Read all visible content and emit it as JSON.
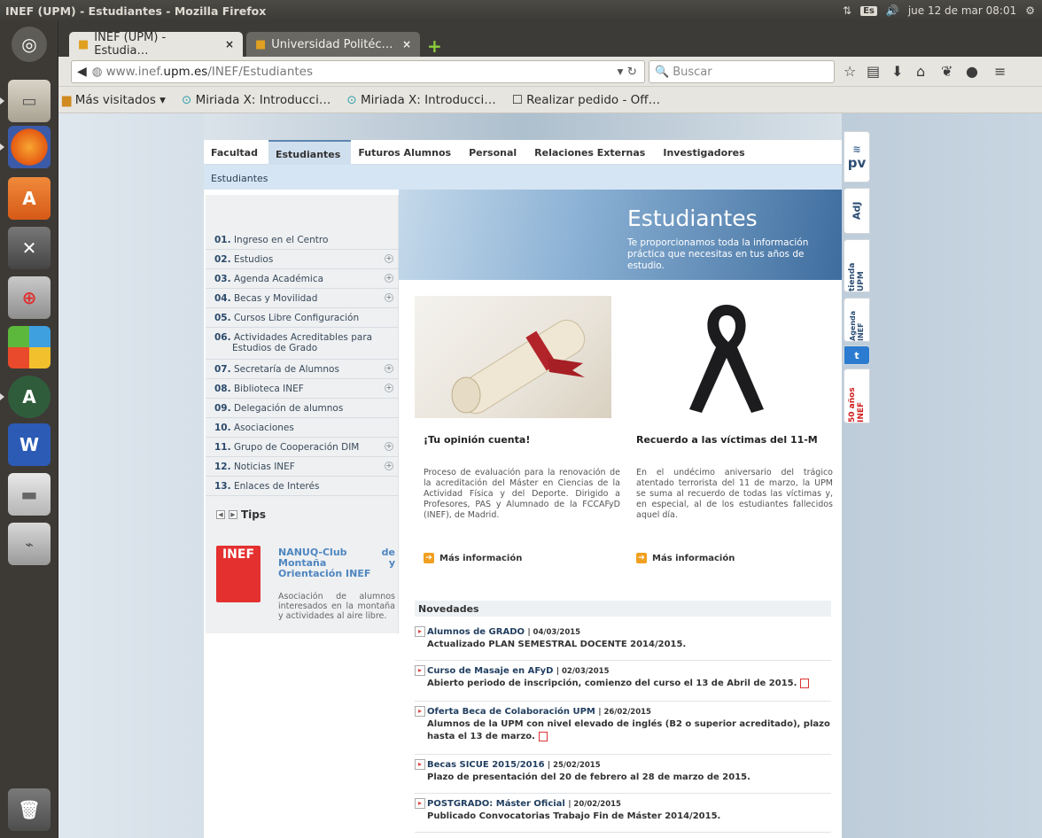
{
  "system": {
    "window_title": "INEF (UPM) - Estudiantes - Mozilla Firefox",
    "keyboard": "Es",
    "datetime": "jue 12 de mar 08:01"
  },
  "browser": {
    "tabs": [
      {
        "label": "INEF (UPM) - Estudia…",
        "active": true
      },
      {
        "label": "Universidad Politéc…",
        "active": false
      }
    ],
    "url_prefix": "www.inef.",
    "url_domain": "upm.es",
    "url_path": "/INEF/Estudiantes",
    "search_placeholder": "Buscar",
    "bookmarks": [
      "Más visitados ▾",
      "Miriada X: Introducci…",
      "Miriada X: Introducci…",
      "Realizar pedido - Off…"
    ]
  },
  "site": {
    "main_nav": [
      "Facultad",
      "Estudiantes",
      "Futuros Alumnos",
      "Personal",
      "Relaciones Externas",
      "Investigadores"
    ],
    "breadcrumb": "Estudiantes",
    "hero_title": "Estudiantes",
    "hero_subtitle_1": "Te proporcionamos toda la información",
    "hero_subtitle_2": "práctica que necesitas en tus años de estudio.",
    "sidebar": [
      {
        "num": "01.",
        "label": "Ingreso en el Centro",
        "expand": false
      },
      {
        "num": "02.",
        "label": "Estudios",
        "expand": true
      },
      {
        "num": "03.",
        "label": "Agenda Académica",
        "expand": true
      },
      {
        "num": "04.",
        "label": "Becas y Movilidad",
        "expand": true
      },
      {
        "num": "05.",
        "label": "Cursos Libre Configuración",
        "expand": false
      },
      {
        "num": "06.",
        "label": "Actividades Acreditables para",
        "label2": "Estudios de Grado",
        "expand": false
      },
      {
        "num": "07.",
        "label": "Secretaría de Alumnos",
        "expand": true
      },
      {
        "num": "08.",
        "label": "Biblioteca INEF",
        "expand": true
      },
      {
        "num": "09.",
        "label": "Delegación de alumnos",
        "expand": false
      },
      {
        "num": "10.",
        "label": "Asociaciones",
        "expand": false
      },
      {
        "num": "11.",
        "label": "Grupo de Cooperación DIM",
        "expand": true
      },
      {
        "num": "12.",
        "label": "Noticias INEF",
        "expand": true
      },
      {
        "num": "13.",
        "label": "Enlaces de Interés",
        "expand": false
      }
    ],
    "tips_label": "Tips",
    "nanuq_logo_text": "INEF",
    "nanuq_title": "NANUQ-Club de Montaña y Orientación INEF",
    "nanuq_desc": "Asociación de alumnos interesados en la montaña y actividades al aire libre.",
    "cards": [
      {
        "title": "¡Tu opinión cuenta!",
        "body": "Proceso de evaluación para la renovación de la acreditación del Máster en Ciencias de la Actividad Física y del Deporte. Dirigido a Profesores, PAS y Alumnado de la FCCAFyD (INEF), de Madrid.",
        "more": "Más información"
      },
      {
        "title": "Recuerdo a las víctimas del 11-M",
        "body": "En el undécimo aniversario del trágico atentado terrorista del 11 de marzo, la UPM se suma al recuerdo de todas las víctimas y, en especial, al de los estudiantes fallecidos aquel día.",
        "more": "Más información"
      }
    ],
    "novedades_title": "Novedades",
    "novedades": [
      {
        "title": "Alumnos de GRADO",
        "date": "| 04/03/2015",
        "text": "Actualizado PLAN SEMESTRAL DOCENTE 2014/2015."
      },
      {
        "title": "Curso de Masaje en AFyD",
        "date": "| 02/03/2015",
        "text": "Abierto periodo de inscripción, comienzo del curso el 13 de Abril de 2015."
      },
      {
        "title": "Oferta Beca de Colaboración UPM",
        "date": "| 26/02/2015",
        "text": "Alumnos de la UPM con nivel elevado de inglés (B2 o superior acreditado), plazo hasta el 13 de marzo."
      },
      {
        "title": "Becas SICUE 2015/2016",
        "date": "| 25/02/2015",
        "text": "Plazo de presentación del 20 de febrero al 28 de marzo de 2015."
      },
      {
        "title": "POSTGRADO: Máster Oficial",
        "date": "| 20/02/2015",
        "text": "Publicado Convocatorias Trabajo Fin de Máster 2014/2015."
      }
    ],
    "widgets": [
      "pv",
      "AdJ",
      "tienda UPM",
      "Agenda INEF",
      "50 años INEF"
    ]
  }
}
